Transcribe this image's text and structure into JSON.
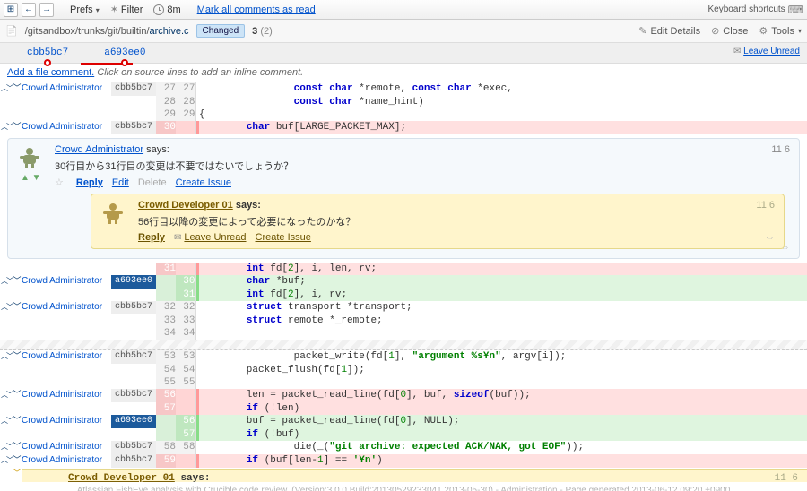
{
  "toolbar": {
    "prefs": "Prefs",
    "filter": "Filter",
    "time": "8m",
    "mark_read": "Mark all comments as read",
    "keyboard": "Keyboard shortcuts"
  },
  "pathbar": {
    "path_prefix": "/gitsandbox/trunks/git/builtin/",
    "path_file": "archive.c",
    "changed": "Changed",
    "count_main": "3",
    "count_paren": "(2)",
    "edit": "Edit Details",
    "close": "Close",
    "tools": "Tools",
    "leave_unread": "Leave Unread"
  },
  "revisions": {
    "left": "cbb5bc7",
    "right": "a693ee0"
  },
  "prompt": {
    "add_comment": "Add a file comment.",
    "hint": "Click on source lines to add an inline comment."
  },
  "authors": {
    "admin": "Crowd Administrator",
    "dev01": "Crowd Developer 01"
  },
  "rev_badges": {
    "gray": "cbb5bc7",
    "blue": "a693ee0"
  },
  "code": {
    "r27": "                const char *remote, const char *exec,",
    "r28": "                const char *name_hint)",
    "r29": "{",
    "r30": "        char buf[LARGE_PACKET_MAX];",
    "r31_del": "        int fd[2], i, len, rv;",
    "r30_add": "        char *buf;",
    "r31_add": "        int fd[2], i, rv;",
    "r32": "        struct transport *transport;",
    "r33": "        struct remote *_remote;",
    "r34": "",
    "r53": "                packet_write(fd[1], \"argument %s¥n\", argv[i]);",
    "r54": "        packet_flush(fd[1]);",
    "r55": "",
    "r56_del": "        len = packet_read_line(fd[0], buf, sizeof(buf));",
    "r57_del": "        if (!len)",
    "r56_add": "        buf = packet_read_line(fd[0], NULL);",
    "r57_add": "        if (!buf)",
    "r58": "                die(_(\"git archive: expected ACK/NAK, got EOF\"));",
    "r59_del": "        if (buf[len-1] == '¥n')"
  },
  "comment1": {
    "author": "Crowd Administrator",
    "says": "says:",
    "body": "30行目から31行目の変更は不要ではないでしょうか？",
    "reply": "Reply",
    "edit": "Edit",
    "delete": "Delete",
    "create_issue": "Create Issue",
    "lineref": "11 6"
  },
  "comment2": {
    "author": "Crowd Developer 01",
    "says": "says:",
    "body": "56行目以降の変更によって必要になったのかな？",
    "reply": "Reply",
    "leave_unread": "Leave Unread",
    "create_issue": "Create Issue",
    "lineref": "11 6"
  },
  "comment3": {
    "author": "Crowd Developer 01",
    "says_label": "says:",
    "lineref": "11 6"
  },
  "footer": "Atlassian FishEye analysis with Crucible code review. (Version:3.0.0 Build:20130529233041 2013-05-30) - Administration - Page generated 2013-06-12 09:20 +0900"
}
